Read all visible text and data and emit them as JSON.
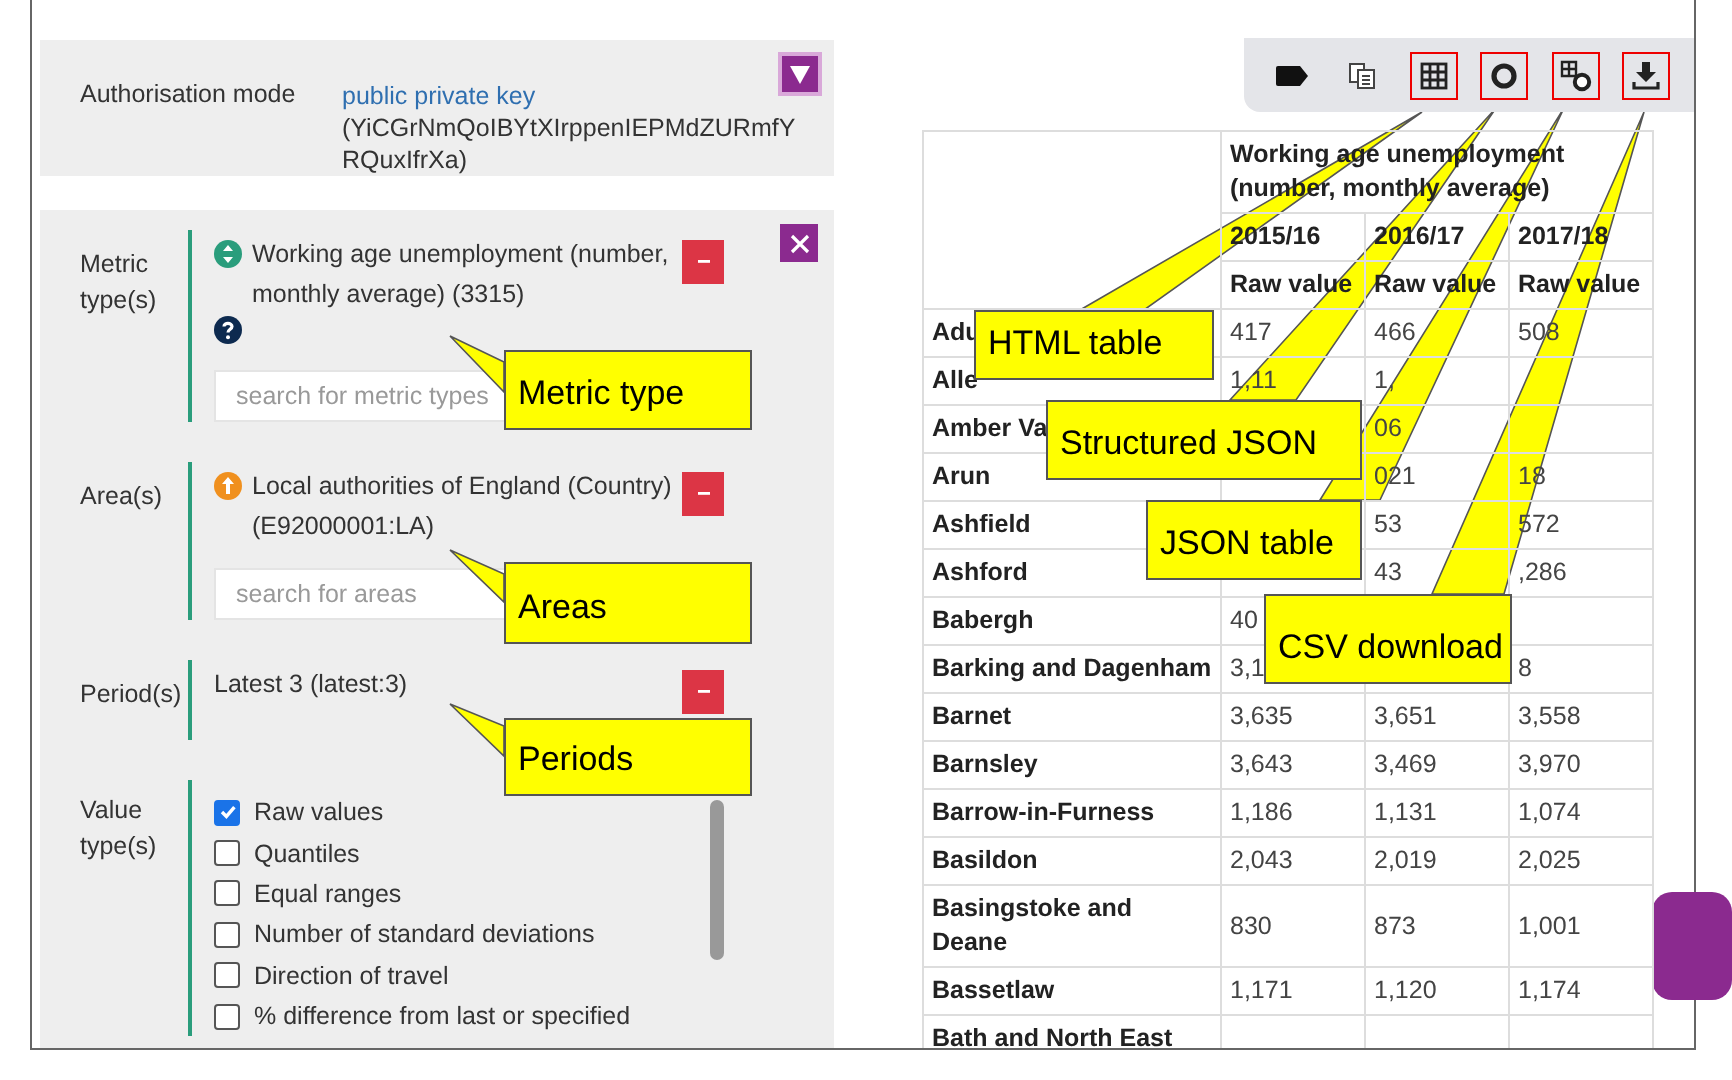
{
  "auth": {
    "label": "Authorisation mode",
    "link": "public private key",
    "key": "(YiCGrNmQoIBYtXIrppenIEPMdZURmfYRQuxIfrXa)"
  },
  "filters": [
    {
      "kind": "metric",
      "label": "Metric type(s)",
      "value": "Working age unemployment (number, monthly average) (3315)",
      "placeholder": "search for metric types"
    },
    {
      "kind": "area",
      "label": "Area(s)",
      "value": "Local authorities of England (Country) (E92000001:LA)",
      "placeholder": "search for areas"
    },
    {
      "kind": "period",
      "label": "Period(s)",
      "value": "Latest 3 (latest:3)"
    },
    {
      "kind": "value_types",
      "label": "Value type(s)",
      "options": [
        {
          "label": "Raw values",
          "checked": true
        },
        {
          "label": "Quantiles",
          "checked": false
        },
        {
          "label": "Equal ranges",
          "checked": false
        },
        {
          "label": "Number of standard deviations",
          "checked": false
        },
        {
          "label": "Direction of travel",
          "checked": false
        },
        {
          "label": "% difference from last or specified",
          "checked": false
        }
      ]
    }
  ],
  "toolbar": [
    {
      "kind": "tag",
      "highlighted": false
    },
    {
      "kind": "copy",
      "highlighted": false
    },
    {
      "kind": "grid",
      "highlighted": true
    },
    {
      "kind": "ring",
      "highlighted": true
    },
    {
      "kind": "grid-ring",
      "highlighted": true
    },
    {
      "kind": "download",
      "highlighted": true
    }
  ],
  "table": {
    "metric": "Working age unemployment (number, monthly average)",
    "periods": [
      "2015/16",
      "2016/17",
      "2017/18"
    ],
    "subheaders": [
      "Raw value",
      "Raw value",
      "Raw value"
    ],
    "rows": [
      {
        "name": "Adu",
        "col_1": "417",
        "col_2": "466",
        "col_3": "508"
      },
      {
        "name": "Alle",
        "col_1": "1,11",
        "col_2": "1,"
      },
      {
        "name": "Amber Va",
        "col_2": "06"
      },
      {
        "name": "Arun",
        "col_2": "021",
        "col_3": "18"
      },
      {
        "name": "Ashfield",
        "col_2": "53",
        "col_3": "572"
      },
      {
        "name": "Ashford",
        "col_2": "43",
        "col_3": ",286"
      },
      {
        "name": "Babergh",
        "col_1": "40"
      },
      {
        "name": "Barking and Dagenham",
        "col_1": "3,1",
        "col_3": "8"
      },
      {
        "name": "Barnet",
        "col_1": "3,635",
        "col_2": "3,651",
        "col_3": "3,558"
      },
      {
        "name": "Barnsley",
        "col_1": "3,643",
        "col_2": "3,469",
        "col_3": "3,970"
      },
      {
        "name": "Barrow-in-Furness",
        "col_1": "1,186",
        "col_2": "1,131",
        "col_3": "1,074"
      },
      {
        "name": "Basildon",
        "col_1": "2,043",
        "col_2": "2,019",
        "col_3": "2,025"
      },
      {
        "name": "Basingstoke and Deane",
        "col_1": "830",
        "col_2": "873",
        "col_3": "1,001"
      },
      {
        "name": "Bassetlaw",
        "col_1": "1,171",
        "col_2": "1,120",
        "col_3": "1,174"
      },
      {
        "name": "Bath and North East"
      }
    ]
  },
  "callouts": [
    {
      "text": "Metric type"
    },
    {
      "text": "Areas"
    },
    {
      "text": "Periods"
    },
    {
      "text": "HTML table"
    },
    {
      "text": "Structured JSON"
    },
    {
      "text": "JSON table"
    },
    {
      "text": "CSV download"
    }
  ]
}
